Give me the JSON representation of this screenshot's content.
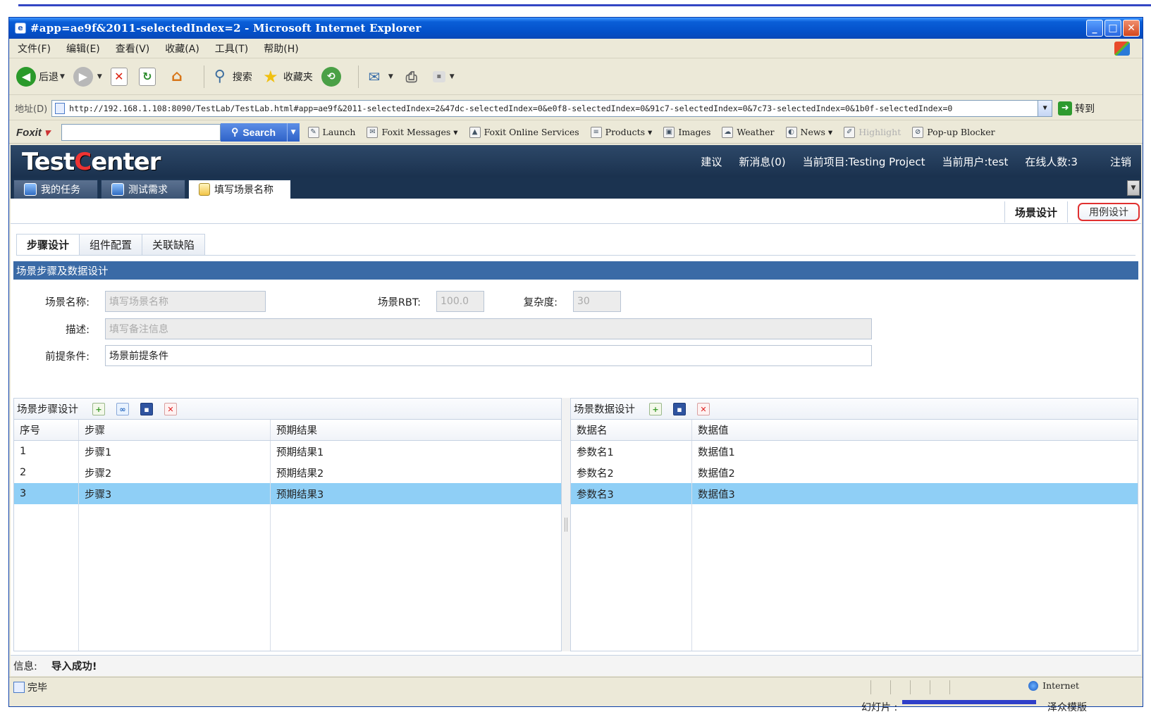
{
  "window": {
    "title": "#app=ae9f&2011-selectedIndex=2 - Microsoft Internet Explorer"
  },
  "menu": [
    "文件(F)",
    "编辑(E)",
    "查看(V)",
    "收藏(A)",
    "工具(T)",
    "帮助(H)"
  ],
  "toolbar": {
    "back_label": "后退",
    "search_label": "搜索",
    "favorites_label": "收藏夹"
  },
  "address": {
    "label": "地址(D)",
    "url": "http://192.168.1.108:8090/TestLab/TestLab.html#app=ae9f&2011-selectedIndex=2&47dc-selectedIndex=0&e0f8-selectedIndex=0&91c7-selectedIndex=0&7c73-selectedIndex=0&1b0f-selectedIndex=0",
    "go_label": "转到"
  },
  "foxit": {
    "logo": "Foxit",
    "search_label": "Search",
    "items": [
      "Launch",
      "Foxit Messages",
      "Foxit Online Services",
      "Products",
      "Images",
      "Weather",
      "News",
      "Highlight",
      "Pop-up Blocker"
    ]
  },
  "app": {
    "logo_part1": "Test",
    "logo_part2": "C",
    "logo_part3": "enter",
    "nav": {
      "suggest": "建议",
      "messages": "新消息(0)",
      "project": "当前项目:Testing Project",
      "user": "当前用户:test",
      "online": "在线人数:3",
      "logout": "注销"
    },
    "tabs": [
      "我的任务",
      "测试需求",
      "填写场景名称"
    ],
    "design_tabs": {
      "scene": "场景设计",
      "usecase": "用例设计"
    },
    "inner_tabs": [
      "步骤设计",
      "组件配置",
      "关联缺陷"
    ],
    "section_title": "场景步骤及数据设计",
    "form": {
      "scene_name_label": "场景名称:",
      "scene_name_placeholder": "填写场景名称",
      "rbt_label": "场景RBT:",
      "rbt_value": "100.0",
      "complexity_label": "复杂度:",
      "complexity_value": "30",
      "desc_label": "描述:",
      "desc_placeholder": "填写备注信息",
      "precondition_label": "前提条件:",
      "precondition_value": "场景前提条件"
    },
    "steps_panel": {
      "title": "场景步骤设计",
      "columns": [
        "序号",
        "步骤",
        "预期结果"
      ],
      "rows": [
        [
          "1",
          "步骤1",
          "预期结果1"
        ],
        [
          "2",
          "步骤2",
          "预期结果2"
        ],
        [
          "3",
          "步骤3",
          "预期结果3"
        ]
      ]
    },
    "data_panel": {
      "title": "场景数据设计",
      "columns": [
        "数据名",
        "数据值"
      ],
      "rows": [
        [
          "参数名1",
          "数据值1"
        ],
        [
          "参数名2",
          "数据值2"
        ],
        [
          "参数名3",
          "数据值3"
        ]
      ]
    },
    "info_label": "信息:",
    "info_message": "导入成功!"
  },
  "status": {
    "text": "完毕",
    "zone": "Internet"
  },
  "below": {
    "slide_label": "幻灯片 :",
    "template_label": "泽众模版"
  },
  "colors": {
    "titlebar": "#0a5fd8",
    "app_header": "#1a314e",
    "section_header": "#3a6aa6",
    "selected_row": "#8fcff6",
    "usecase_border": "#e03030"
  }
}
